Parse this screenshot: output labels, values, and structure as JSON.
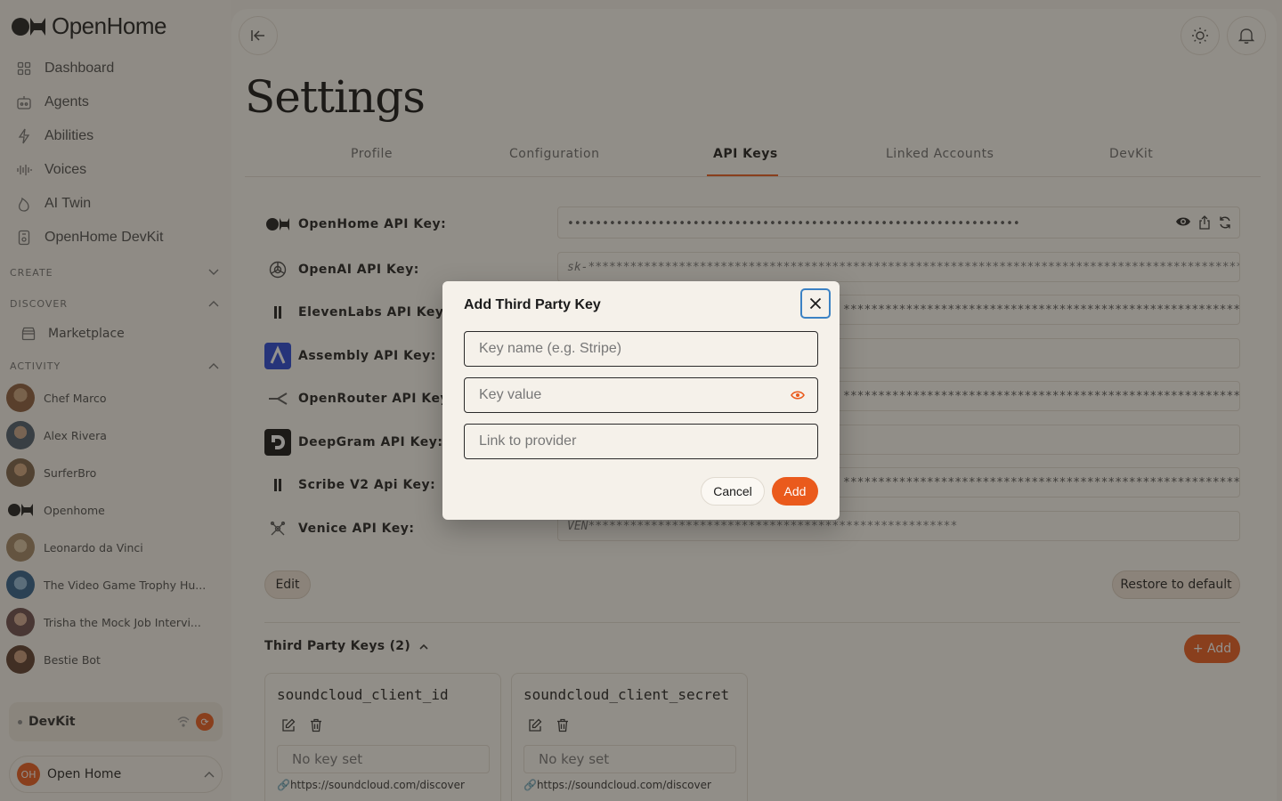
{
  "app": {
    "name": "OpenHome"
  },
  "sidebar": {
    "nav": [
      {
        "label": "Dashboard",
        "icon": "grid-icon"
      },
      {
        "label": "Agents",
        "icon": "robot-icon"
      },
      {
        "label": "Abilities",
        "icon": "lightning-icon"
      },
      {
        "label": "Voices",
        "icon": "waveform-icon"
      },
      {
        "label": "AI Twin",
        "icon": "flame-icon"
      },
      {
        "label": "OpenHome DevKit",
        "icon": "device-icon"
      }
    ],
    "create_label": "CREATE",
    "discover_label": "DISCOVER",
    "marketplace_label": "Marketplace",
    "activity_label": "ACTIVITY",
    "activity": [
      {
        "label": "Chef Marco",
        "color": "#8a5a3a"
      },
      {
        "label": "Alex Rivera",
        "color": "#4a5b6b"
      },
      {
        "label": "SurferBro",
        "color": "#7a6046"
      },
      {
        "label": "Openhome",
        "color": "#1c1c1c"
      },
      {
        "label": "Leonardo da Vinci",
        "color": "#a08462"
      },
      {
        "label": "The Video Game Trophy Hu...",
        "color": "#2f5f8a"
      },
      {
        "label": "Trisha the Mock Job Intervi...",
        "color": "#6a4a4a"
      },
      {
        "label": "Bestie Bot",
        "color": "#5a3a2a"
      }
    ],
    "devkit_label": "DevKit",
    "user": {
      "initials": "OH",
      "name": "Open Home"
    }
  },
  "page": {
    "title": "Settings",
    "tabs": [
      "Profile",
      "Configuration",
      "API Keys",
      "Linked Accounts",
      "DevKit"
    ],
    "active_tab": "API Keys"
  },
  "api_keys": [
    {
      "label": "OpenHome API Key:",
      "value": "•••••••••••••••••••••••••••••••••••••••••••••••••••••••••••••••••",
      "icon": "openhome-logo-icon"
    },
    {
      "label": "OpenAI API Key:",
      "value": "sk-************************************************************************************************",
      "icon": "openai-icon"
    },
    {
      "label": "ElevenLabs API Key:",
      "value": "*****************************************************************",
      "icon": "elevenlabs-icon"
    },
    {
      "label": "Assembly API Key:",
      "value": "",
      "icon": "assembly-icon"
    },
    {
      "label": "OpenRouter API Key:",
      "value": "***************************************************************************************",
      "icon": "openrouter-icon"
    },
    {
      "label": "DeepGram API Key:",
      "value": "",
      "icon": "deepgram-icon"
    },
    {
      "label": "Scribe V2 Api Key:",
      "value": "*****************************************************************",
      "icon": "elevenlabs-icon"
    },
    {
      "label": "Venice API Key:",
      "value": "VEN*****************************************************",
      "icon": "venice-icon"
    }
  ],
  "buttons": {
    "edit": "Edit",
    "restore": "Restore to default",
    "add": "+ Add"
  },
  "third_party": {
    "heading": "Third Party Keys (2)",
    "cards": [
      {
        "title": "soundcloud_client_id",
        "placeholder": "No key set",
        "link": "🔗https://soundcloud.com/discover"
      },
      {
        "title": "soundcloud_client_secret",
        "placeholder": "No key set",
        "link": "🔗https://soundcloud.com/discover"
      }
    ]
  },
  "modal": {
    "title": "Add Third Party Key",
    "key_name_placeholder": "Key name (e.g. Stripe)",
    "key_value_placeholder": "Key value",
    "link_placeholder": "Link to provider",
    "cancel": "Cancel",
    "add": "Add"
  }
}
